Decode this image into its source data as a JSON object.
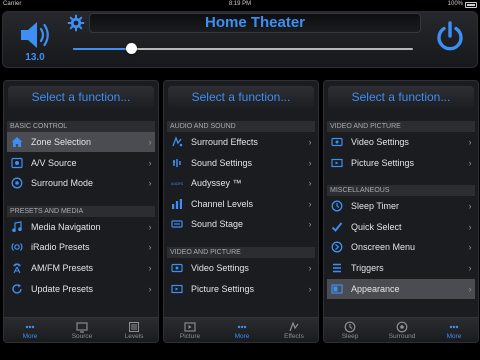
{
  "status_bar": {
    "carrier": "Carrier",
    "time": "8:19 PM",
    "battery": "100%"
  },
  "header": {
    "title": "Home Theater",
    "volume_value": "13.0",
    "volume_level_percent": 17
  },
  "panels": [
    {
      "header": "Select a function...",
      "sections": [
        {
          "title": "BASIC CONTROL",
          "items": [
            {
              "label": "Zone Selection",
              "icon": "home-icon",
              "selected": true
            },
            {
              "label": "A/V Source",
              "icon": "source-icon"
            },
            {
              "label": "Surround Mode",
              "icon": "surround-icon"
            }
          ]
        },
        {
          "title": "PRESETS AND MEDIA",
          "items": [
            {
              "label": "Media Navigation",
              "icon": "music-note-icon"
            },
            {
              "label": "iRadio Presets",
              "icon": "radio-icon"
            },
            {
              "label": "AM/FM Presets",
              "icon": "broadcast-icon"
            },
            {
              "label": "Update Presets",
              "icon": "refresh-icon"
            }
          ]
        }
      ],
      "tabs": [
        {
          "label": "More",
          "icon": "more-dots-icon",
          "active": true
        },
        {
          "label": "Source",
          "icon": "source-tab-icon"
        },
        {
          "label": "Levels",
          "icon": "levels-icon"
        }
      ]
    },
    {
      "header": "Select a function...",
      "sections": [
        {
          "title": "AUDIO AND SOUND",
          "items": [
            {
              "label": "Surround Effects",
              "icon": "effects-icon"
            },
            {
              "label": "Sound Settings",
              "icon": "sound-settings-icon"
            },
            {
              "label": "Audyssey ™",
              "icon": "audyssey-icon",
              "icon_text": "AUDYSSEY"
            },
            {
              "label": "Channel Levels",
              "icon": "channel-levels-icon"
            },
            {
              "label": "Sound Stage",
              "icon": "sound-stage-icon"
            }
          ]
        },
        {
          "title": "VIDEO AND PICTURE",
          "items": [
            {
              "label": "Video Settings",
              "icon": "video-settings-icon"
            },
            {
              "label": "Picture Settings",
              "icon": "picture-settings-icon"
            }
          ]
        }
      ],
      "tabs": [
        {
          "label": "Picture",
          "icon": "picture-icon"
        },
        {
          "label": "More",
          "icon": "more-dots-icon",
          "active": true
        },
        {
          "label": "Effects",
          "icon": "effects-tab-icon"
        }
      ]
    },
    {
      "header": "Select a function...",
      "sections": [
        {
          "title": "VIDEO AND PICTURE",
          "items": [
            {
              "label": "Video Settings",
              "icon": "video-settings-icon"
            },
            {
              "label": "Picture Settings",
              "icon": "picture-settings-icon"
            }
          ]
        },
        {
          "title": "MISCELLANEOUS",
          "items": [
            {
              "label": "Sleep Timer",
              "icon": "clock-icon"
            },
            {
              "label": "Quick Select",
              "icon": "checkmark-icon"
            },
            {
              "label": "Onscreen Menu",
              "icon": "menu-icon"
            },
            {
              "label": "Triggers",
              "icon": "triggers-icon"
            },
            {
              "label": "Appearance",
              "icon": "appearance-icon",
              "selected": true
            }
          ]
        }
      ],
      "tabs": [
        {
          "label": "Sleep",
          "icon": "sleep-icon"
        },
        {
          "label": "Surround",
          "icon": "surround-tab-icon"
        },
        {
          "label": "More",
          "icon": "more-dots-icon",
          "active": true
        }
      ]
    }
  ],
  "colors": {
    "accent": "#3d8ff3",
    "background": "#000000",
    "panel": "#1b1c1f",
    "selected_row": "#4a4c51"
  }
}
